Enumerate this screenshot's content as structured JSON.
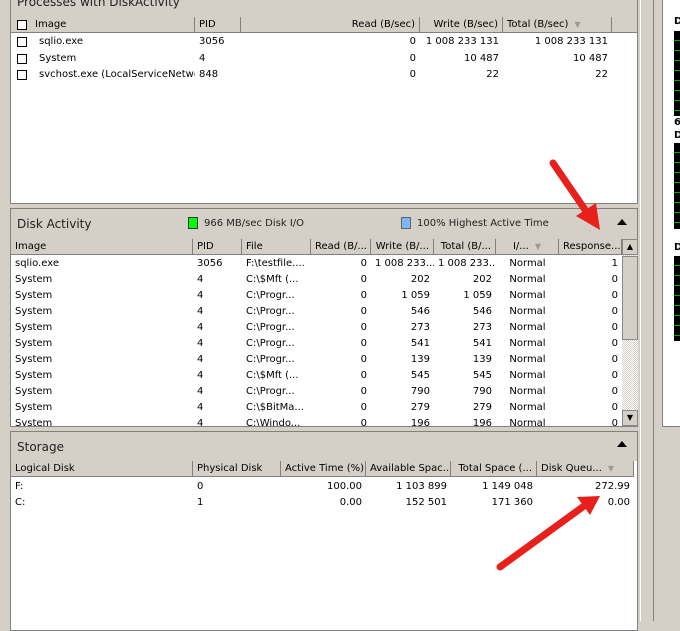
{
  "processes": {
    "title": "Processes with DiskActivity",
    "columns": [
      "Image",
      "PID",
      "Read (B/sec)",
      "Write (B/sec)",
      "Total (B/sec)"
    ],
    "rows": [
      [
        "sqlio.exe",
        "3056",
        "0",
        "1 008 233 131",
        "1 008 233 131"
      ],
      [
        "System",
        "4",
        "0",
        "10 487",
        "10 487"
      ],
      [
        "svchost.exe (LocalServiceNetwo...",
        "848",
        "0",
        "22",
        "22"
      ]
    ]
  },
  "disk_activity": {
    "title": "Disk Activity",
    "io_label": "966 MB/sec Disk I/O",
    "io_color": "#00ff00",
    "active_label": "100% Highest Active Time",
    "active_color": "#7cb6f8",
    "columns": [
      "Image",
      "PID",
      "File",
      "Read (B/...",
      "Write (B/...",
      "Total (B/...",
      "I/...",
      "Response..."
    ],
    "rows": [
      [
        "sqlio.exe",
        "3056",
        "F:\\testfile....",
        "0",
        "1 008 233...",
        "1 008 233...",
        "Normal",
        "1"
      ],
      [
        "System",
        "4",
        "C:\\$Mft (...",
        "0",
        "202",
        "202",
        "Normal",
        "0"
      ],
      [
        "System",
        "4",
        "C:\\Progr...",
        "0",
        "1 059",
        "1 059",
        "Normal",
        "0"
      ],
      [
        "System",
        "4",
        "C:\\Progr...",
        "0",
        "546",
        "546",
        "Normal",
        "0"
      ],
      [
        "System",
        "4",
        "C:\\Progr...",
        "0",
        "273",
        "273",
        "Normal",
        "0"
      ],
      [
        "System",
        "4",
        "C:\\Progr...",
        "0",
        "541",
        "541",
        "Normal",
        "0"
      ],
      [
        "System",
        "4",
        "C:\\Progr...",
        "0",
        "139",
        "139",
        "Normal",
        "0"
      ],
      [
        "System",
        "4",
        "C:\\$Mft (...",
        "0",
        "545",
        "545",
        "Normal",
        "0"
      ],
      [
        "System",
        "4",
        "C:\\Progr...",
        "0",
        "790",
        "790",
        "Normal",
        "0"
      ],
      [
        "System",
        "4",
        "C:\\$BitMa...",
        "0",
        "279",
        "279",
        "Normal",
        "0"
      ],
      [
        "System",
        "4",
        "C:\\Windo...",
        "0",
        "196",
        "196",
        "Normal",
        "0"
      ]
    ]
  },
  "storage": {
    "title": "Storage",
    "columns": [
      "Logical Disk",
      "Physical Disk",
      "Active Time (%)",
      "Available Spac...",
      "Total Space (...",
      "Disk Queu..."
    ],
    "rows": [
      [
        "F:",
        "0",
        "100.00",
        "1 103 899",
        "1 149 048",
        "272.99"
      ],
      [
        "C:",
        "1",
        "0.00",
        "152 501",
        "171 360",
        "0.00"
      ]
    ]
  },
  "right_panel": {
    "labels": [
      "D",
      "6",
      "D",
      "D"
    ]
  },
  "annotation_color": "#e8201c"
}
